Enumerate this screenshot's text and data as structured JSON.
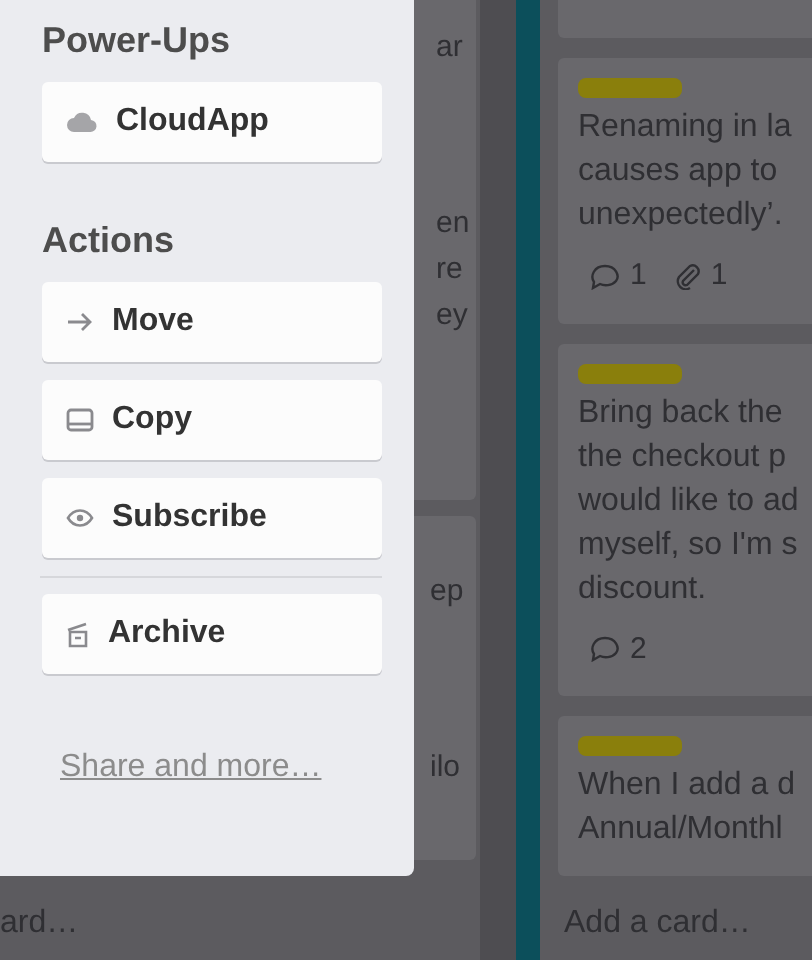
{
  "menu": {
    "sections": [
      {
        "title": "Power-Ups",
        "buttons": [
          {
            "label": "CloudApp",
            "divider_before": false
          }
        ]
      },
      {
        "title": "Actions",
        "buttons": [
          {
            "label": "Move",
            "divider_before": false
          },
          {
            "label": "Copy",
            "divider_before": false
          },
          {
            "label": "Subscribe",
            "divider_before": false
          },
          {
            "label": "Archive",
            "divider_before": true
          }
        ]
      }
    ],
    "link": "Share and more…"
  },
  "left_list": {
    "fragments": [
      "ar",
      "en",
      "re",
      "ey",
      "ep",
      "ilo"
    ],
    "add_card": "ard…"
  },
  "right_list": {
    "cards": [
      {
        "lines": [
          "Renaming in la",
          "causes app to",
          "unexpectedly’."
        ],
        "badges": [
          {
            "kind": "comments",
            "count": "1"
          },
          {
            "kind": "attachments",
            "count": "1"
          }
        ]
      },
      {
        "lines": [
          "Bring back the",
          "the checkout p",
          "would like to ad",
          "myself, so I'm s",
          "discount."
        ],
        "badges": [
          {
            "kind": "comments",
            "count": "2"
          }
        ]
      },
      {
        "lines": [
          "When I add a d",
          "Annual/Monthl"
        ]
      }
    ],
    "add_card": "Add a card…"
  }
}
